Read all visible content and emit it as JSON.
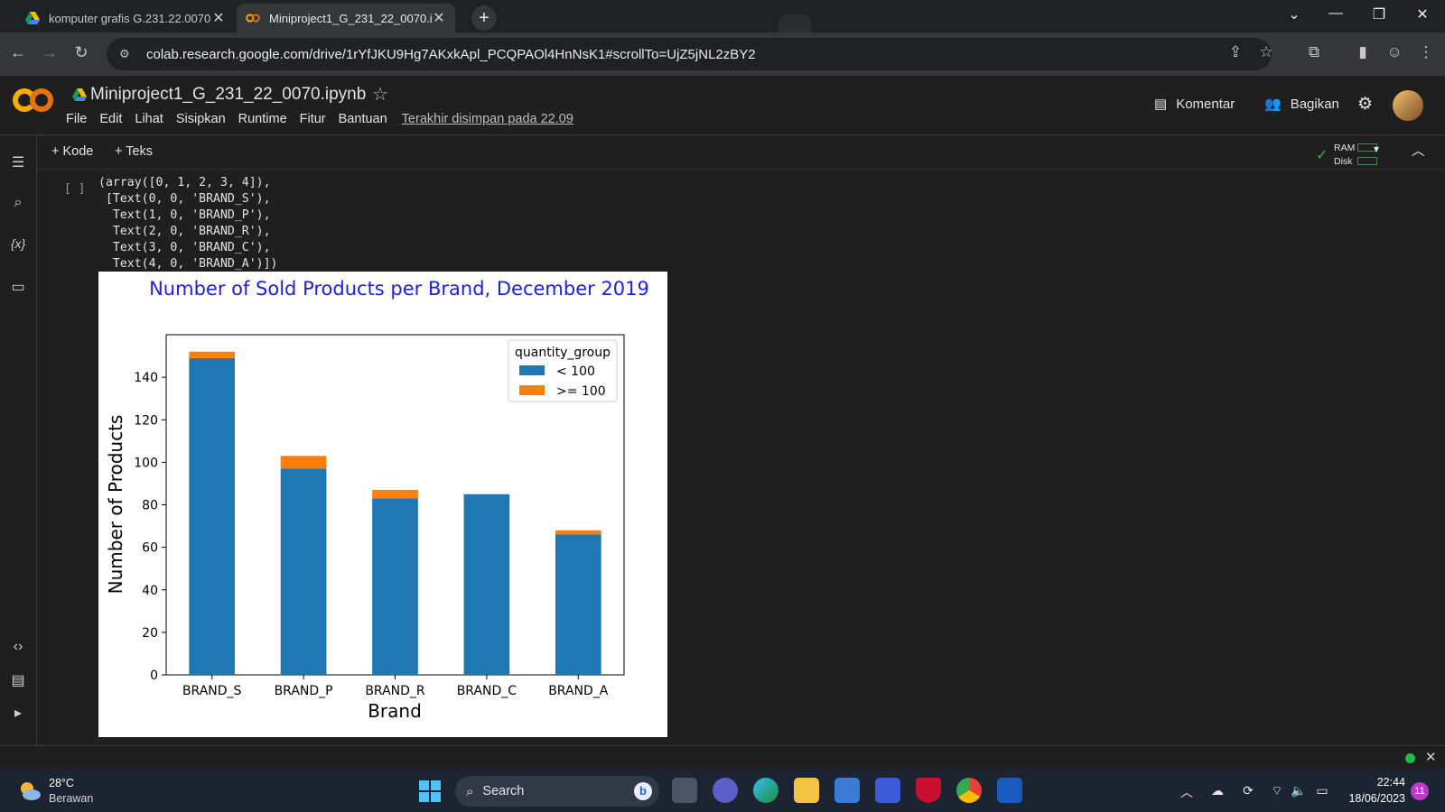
{
  "browser": {
    "tabs": [
      {
        "label": "komputer grafis G.231.22.0070",
        "active": false
      },
      {
        "label": "Miniproject1_G_231_22_0070.ip",
        "active": true
      }
    ],
    "url": "colab.research.google.com/drive/1rYfJKU9Hg7AKxkApl_PCQPAOl4HnNsK1#scrollTo=UjZ5jNL2zBY2"
  },
  "colab": {
    "notebook_title": "Miniproject1_G_231_22_0070.ipynb",
    "menu": [
      "File",
      "Edit",
      "Lihat",
      "Sisipkan",
      "Runtime",
      "Fitur",
      "Bantuan"
    ],
    "last_saved": "Terakhir disimpan pada 22.09",
    "comment_label": "Komentar",
    "share_label": "Bagikan",
    "add_code": "+ Kode",
    "add_text": "+ Teks",
    "ram_label": "RAM",
    "disk_label": "Disk"
  },
  "cell": {
    "run_indicator": "[ ]",
    "output_text": "(array([0, 1, 2, 3, 4]),\n [Text(0, 0, 'BRAND_S'),\n  Text(1, 0, 'BRAND_P'),\n  Text(2, 0, 'BRAND_R'),\n  Text(3, 0, 'BRAND_C'),\n  Text(4, 0, 'BRAND_A')])"
  },
  "chart_data": {
    "type": "bar",
    "stacked": true,
    "title": "Number of Sold Products per Brand, December 2019",
    "xlabel": "Brand",
    "ylabel": "Number of Products",
    "categories": [
      "BRAND_S",
      "BRAND_P",
      "BRAND_R",
      "BRAND_C",
      "BRAND_A"
    ],
    "series": [
      {
        "name": "< 100",
        "values": [
          149,
          97,
          83,
          85,
          66
        ],
        "color": "#1f77b4"
      },
      {
        "name": ">= 100",
        "values": [
          3,
          6,
          4,
          0,
          2
        ],
        "color": "#ff7f0e"
      }
    ],
    "legend_title": "quantity_group",
    "legend_position": "top-right",
    "ylim": [
      0,
      160
    ],
    "yticks": [
      0,
      20,
      40,
      60,
      80,
      100,
      120,
      140
    ],
    "title_color": "#1f1fd6",
    "grid": false
  },
  "taskbar": {
    "temperature": "28°C",
    "weather": "Berawan",
    "search_placeholder": "Search",
    "time": "22:44",
    "date": "18/06/2023",
    "notifications": "11"
  }
}
